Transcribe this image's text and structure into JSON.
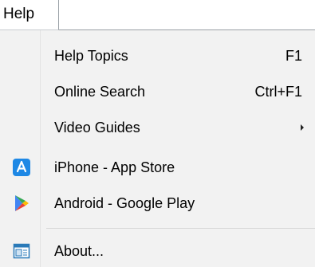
{
  "menubar": {
    "help_label": "Help"
  },
  "menu": {
    "items": [
      {
        "label": "Help Topics",
        "shortcut": "F1"
      },
      {
        "label": "Online Search",
        "shortcut": "Ctrl+F1"
      },
      {
        "label": "Video Guides",
        "shortcut": ""
      },
      {
        "label": "iPhone - App Store",
        "shortcut": "",
        "icon": "app-store-icon"
      },
      {
        "label": "Android - Google Play",
        "shortcut": "",
        "icon": "google-play-icon"
      },
      {
        "label": "About...",
        "shortcut": "",
        "icon": "about-window-icon"
      }
    ]
  },
  "colors": {
    "menu_background": "#f2f2f2",
    "app_store_blue": "#1e88e5",
    "play_green": "#34a853",
    "play_blue": "#4285f4",
    "play_red": "#ea4335",
    "play_yellow": "#fbbc05"
  }
}
